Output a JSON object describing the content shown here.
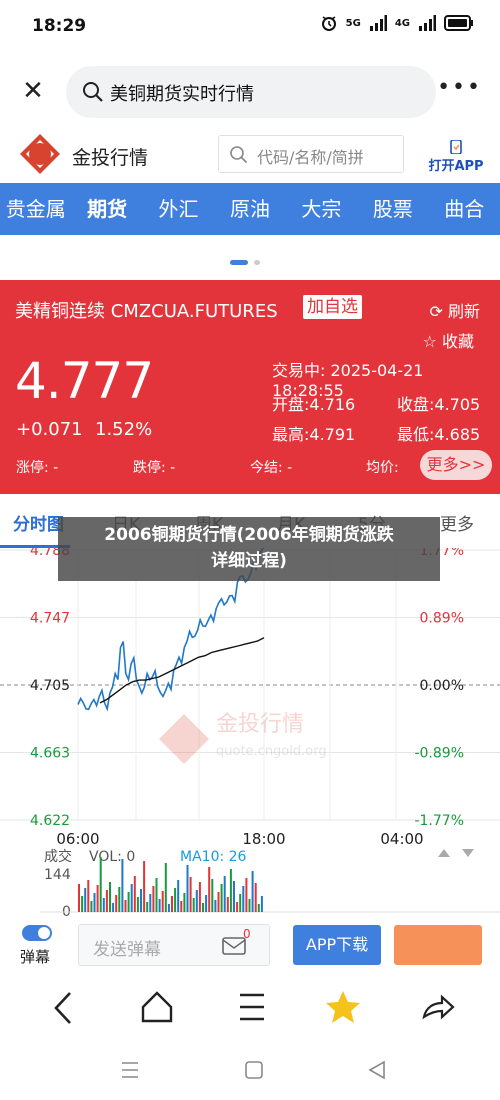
{
  "status": {
    "time": "18:29",
    "net1": "5G",
    "net2": "4G"
  },
  "search": {
    "close_icon": "close-icon",
    "query": "美铜期货实时行情",
    "more_icon": "more-icon"
  },
  "brand": {
    "name": "金投行情",
    "logo_text": "Au",
    "code_placeholder": "代码/名称/简拼",
    "open_app": "打开APP"
  },
  "nav": {
    "items": [
      "贵金属",
      "期货",
      "外汇",
      "原油",
      "大宗",
      "股票",
      "曲合"
    ],
    "active": "期货"
  },
  "quote": {
    "title": "美精铜连续 CMZCUA.FUTURES",
    "add_fav": "加自选",
    "refresh": "刷新",
    "collect": "收藏",
    "price": "4.777",
    "change": "+0.071",
    "change_pct": "1.52%",
    "trade_time_label": "交易中:",
    "trade_time": "2025-04-21 18:28:55",
    "open": "开盘:4.716",
    "close": "收盘:4.705",
    "high": "最高:4.791",
    "low": "最低:4.685",
    "limit_up": "涨停: -",
    "limit_down": "跌停: -",
    "settle": "今结: -",
    "avg": "均价:",
    "more": "更多>>",
    "colors": {
      "card": "#e2343a",
      "up": "#e2343a",
      "down": "#1a9a3c"
    }
  },
  "chart_tabs": [
    "分时图",
    "日K",
    "周K",
    "月K",
    "5分",
    "更多"
  ],
  "overlay": {
    "line1": "2006铜期货行情(2006年铜期货涨跌",
    "line2": "详细过程)"
  },
  "chart_data": {
    "type": "line",
    "y_ticks": [
      "4.788",
      "4.747",
      "4.705",
      "4.663",
      "4.622"
    ],
    "y_pct_ticks": [
      "1.77%",
      "0.89%",
      "0.00%",
      "-0.89%",
      "-1.77%"
    ],
    "x_ticks": [
      "06:00",
      "18:00",
      "04:00"
    ],
    "ylim": [
      4.622,
      4.788
    ],
    "reference": 4.705,
    "series": [
      {
        "values": [
          4.693,
          4.694,
          4.69,
          4.696,
          4.698,
          4.694,
          4.7,
          4.712,
          4.728,
          4.712,
          4.718,
          4.708,
          4.7,
          4.712,
          4.71,
          4.704,
          4.698,
          4.706,
          4.714,
          4.722,
          4.728,
          4.738,
          4.735,
          4.745,
          4.741,
          4.748,
          4.752,
          4.758,
          4.756,
          4.76,
          4.768,
          4.772,
          4.77,
          4.78,
          4.784,
          4.79
        ]
      },
      {
        "values": [
          4.694,
          4.696,
          4.699,
          4.702,
          4.705,
          4.707,
          4.708,
          4.708,
          4.709,
          4.71,
          4.712,
          4.714,
          4.716,
          4.718,
          4.72,
          4.722,
          4.723,
          4.725,
          4.726,
          4.727,
          4.728,
          4.729,
          4.73,
          4.731,
          4.732,
          4.734
        ]
      }
    ],
    "volume": {
      "label": "成交",
      "vol_label": "VOL: 0",
      "ma_label": "MA10: 26",
      "max_label": "144",
      "zero_label": "0"
    }
  },
  "watermark": {
    "text": "金投行情",
    "url": "quote.cngold.org"
  },
  "bottom": {
    "danmu": "弹幕",
    "send_placeholder": "发送弹幕",
    "msg_count": "0",
    "app_download": "APP下载"
  },
  "bottom_nav": [
    "back-icon",
    "home-icon",
    "menu-icon",
    "star-icon",
    "share-icon"
  ],
  "sys_nav": [
    "recents-icon",
    "home-square-icon",
    "back-triangle-icon"
  ]
}
